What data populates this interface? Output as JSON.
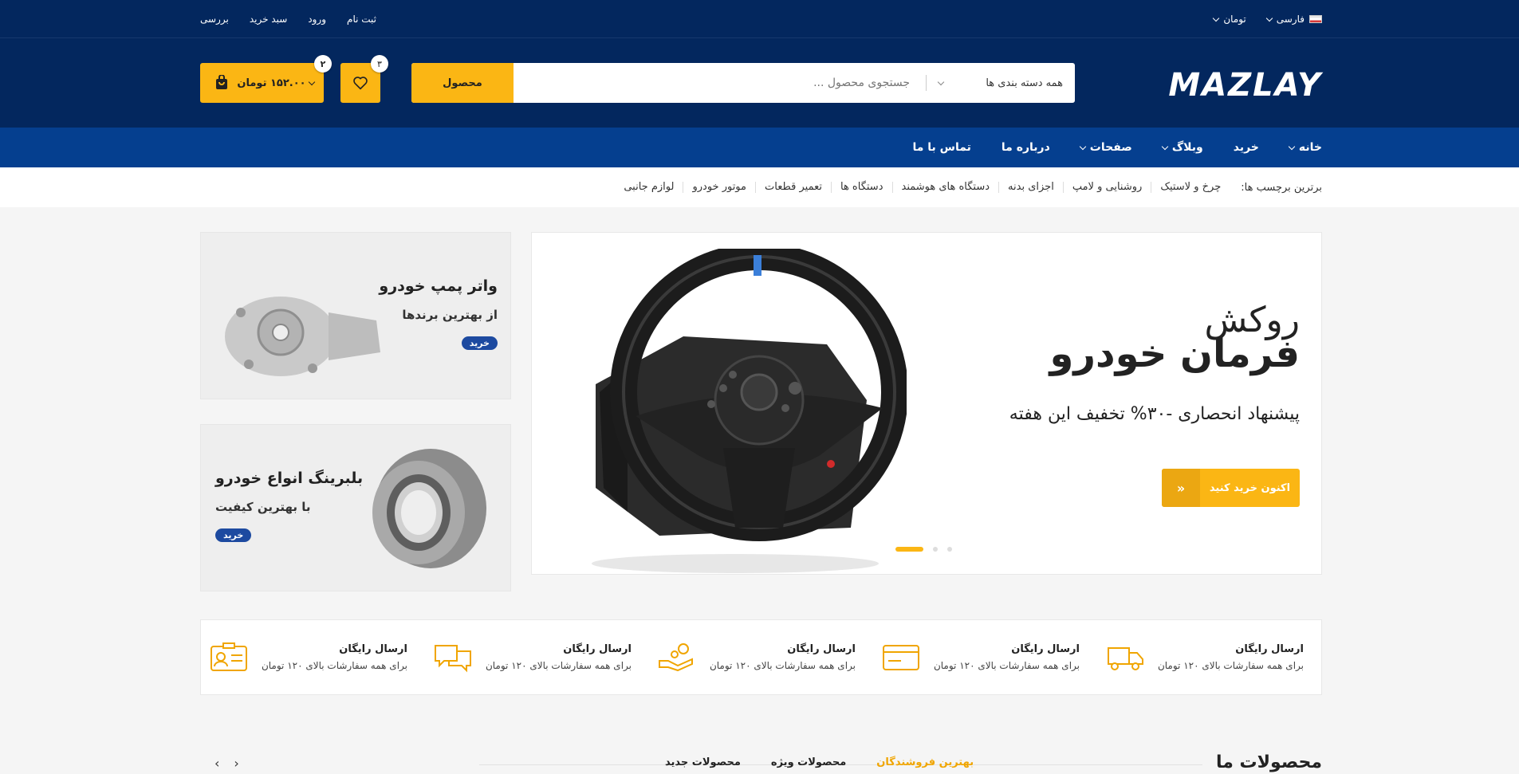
{
  "topbar": {
    "links": [
      "ثبت نام",
      "ورود",
      "سبد خرید",
      "بررسی"
    ],
    "language": "فارسی",
    "currency": "تومان"
  },
  "header": {
    "logo": "mazlay",
    "search": {
      "category": "همه دسته بندی ها",
      "placeholder": "جستجوی محصول ...",
      "button": "محصول"
    },
    "wishlist_count": "۳",
    "cart_count": "۲",
    "cart_total": "۱۵۲.۰۰ تومان"
  },
  "nav": {
    "items": [
      {
        "label": "خانه",
        "has_dropdown": true
      },
      {
        "label": "خرید",
        "has_dropdown": false
      },
      {
        "label": "وبلاگ",
        "has_dropdown": true
      },
      {
        "label": "صفحات",
        "has_dropdown": true
      },
      {
        "label": "درباره ما",
        "has_dropdown": false
      },
      {
        "label": "تماس با ما",
        "has_dropdown": false
      }
    ]
  },
  "tags": {
    "label": "برترین برچسب ها:",
    "items": [
      "چرخ و لاستیک",
      "روشنایی و لامپ",
      "اجزای بدنه",
      "دستگاه های هوشمند",
      "دستگاه ها",
      "تعمیر قطعات",
      "موتور خودرو",
      "لوازم جانبی"
    ]
  },
  "slider": {
    "title1": "روکش",
    "title2": "فرمان خودرو",
    "subtitle": "پیشنهاد انحصاری -۳۰% تخفیف این هفته",
    "button": "اکنون خرید کنید",
    "slide_count": 3,
    "active_slide": 1
  },
  "banners": [
    {
      "title": "واتر پمپ خودرو",
      "subtitle": "از بهترین برندها",
      "button": "خرید"
    },
    {
      "title": "بلبرینگ انواع خودرو",
      "subtitle": "با بهترین کیفیت",
      "button": "خرید"
    }
  ],
  "features": [
    {
      "title": "ارسال رایگان",
      "text": "برای همه سفارشات بالای ۱۲۰ تومان",
      "icon": "delivery-truck-icon"
    },
    {
      "title": "ارسال رایگان",
      "text": "برای همه سفارشات بالای ۱۲۰ تومان",
      "icon": "credit-card-icon"
    },
    {
      "title": "ارسال رایگان",
      "text": "برای همه سفارشات بالای ۱۲۰ تومان",
      "icon": "hand-money-icon"
    },
    {
      "title": "ارسال رایگان",
      "text": "برای همه سفارشات بالای ۱۲۰ تومان",
      "icon": "chat-bubbles-icon"
    },
    {
      "title": "ارسال رایگان",
      "text": "برای همه سفارشات بالای ۱۲۰ تومان",
      "icon": "id-card-icon"
    }
  ],
  "products": {
    "title": "محصولات ما",
    "tabs": [
      "بهترین فروشندگان",
      "محصولات ویژه",
      "محصولات جدید"
    ],
    "active_tab": "بهترین فروشندگان"
  },
  "colors": {
    "dark_blue": "#03275e",
    "nav_blue": "#053f8f",
    "accent": "#fbb614"
  }
}
